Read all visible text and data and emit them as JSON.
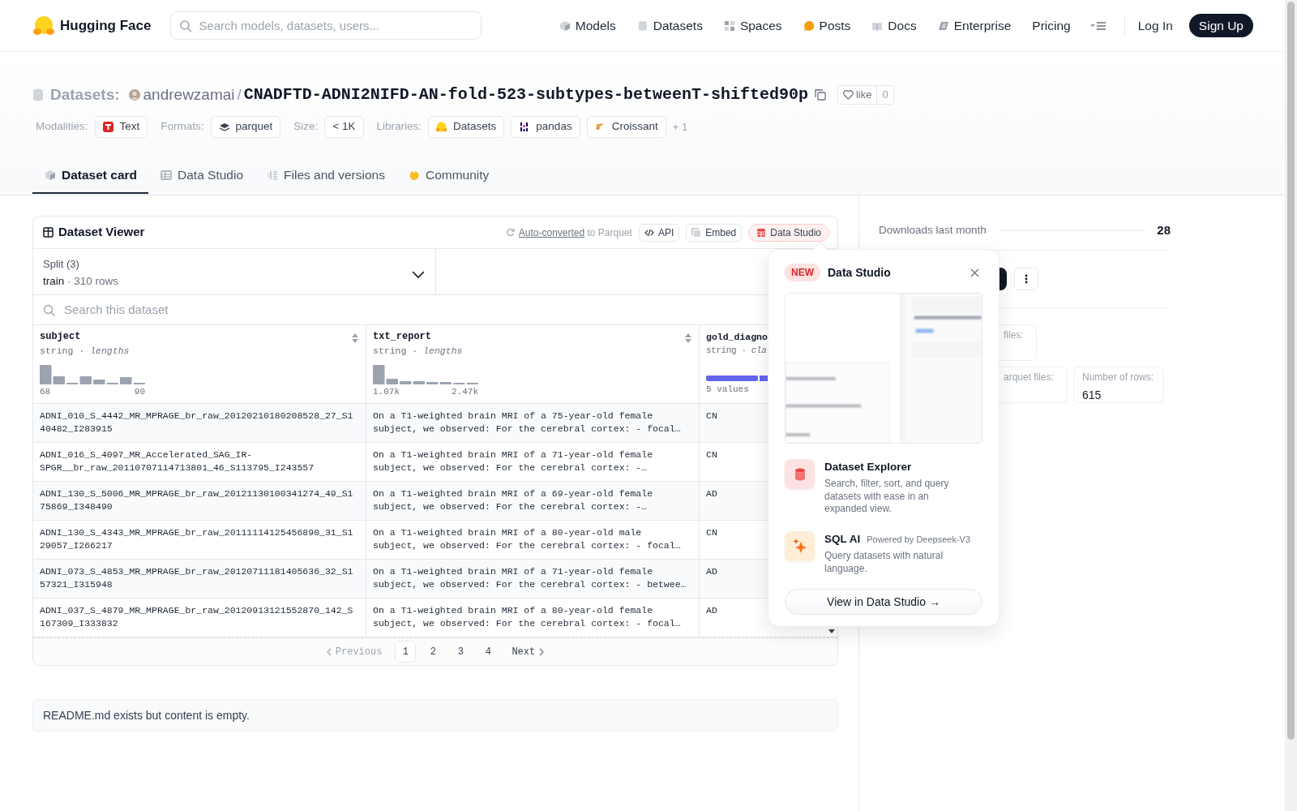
{
  "header": {
    "brand": "Hugging Face",
    "search": {
      "placeholder": "Search models, datasets, users..."
    },
    "nav": [
      {
        "label": "Models"
      },
      {
        "label": "Datasets"
      },
      {
        "label": "Spaces"
      },
      {
        "label": "Posts"
      },
      {
        "label": "Docs"
      },
      {
        "label": "Enterprise"
      },
      {
        "label": "Pricing"
      }
    ],
    "login": "Log In",
    "signup": "Sign Up"
  },
  "dataset": {
    "section": "Datasets:",
    "owner": "andrewzamai",
    "separator": "/",
    "name": "CNADFTD-ADNI2NIFD-AN-fold-523-subtypes-betweenT-shifted90p",
    "like": "like",
    "likes": "0"
  },
  "tags": [
    {
      "label": "Modalities:",
      "chips": [
        "Text"
      ]
    },
    {
      "label": "Formats:",
      "chips": [
        "parquet"
      ]
    },
    {
      "label": "Size:",
      "chips": [
        "< 1K"
      ]
    },
    {
      "label": "Libraries:",
      "chips": [
        "Datasets",
        "pandas",
        "Croissant"
      ]
    }
  ],
  "more_tags": "+ 1",
  "tabs": [
    {
      "label": "Dataset card",
      "selected": true
    },
    {
      "label": "Data Studio",
      "selected": false
    },
    {
      "label": "Files and versions",
      "selected": false
    },
    {
      "label": "Community",
      "selected": false
    }
  ],
  "viewer": {
    "title": "Dataset Viewer",
    "converted_link": "Auto-converted",
    "converted_text": "to Parquet",
    "buttons": [
      {
        "label": "API",
        "active": false
      },
      {
        "label": "Embed",
        "active": false
      },
      {
        "label": "Data Studio",
        "active": true
      }
    ],
    "split": {
      "label": "Split (3)",
      "value": "train",
      "dot": "·",
      "rows": "310 rows"
    },
    "search": {
      "placeholder": "Search this dataset"
    },
    "columns": [
      {
        "kind": "histogram",
        "name": "subject",
        "type": "string",
        "dot": "·",
        "stat": "lengths",
        "min": "68",
        "max": "90"
      },
      {
        "kind": "histogram",
        "name": "txt_report",
        "type": "string",
        "dot": "·",
        "stat": "lengths",
        "min": "1.07k",
        "max": "2.47k"
      },
      {
        "kind": "classes",
        "name": "gold_diagno",
        "type": "string",
        "dot": "·",
        "stat": "cla",
        "summary": "5 values"
      }
    ],
    "rows": [
      [
        "ADNI_010_S_4442_MR_MPRAGE_br_raw_20120210180208528_27_S140482_I283915",
        "On a T1-weighted brain MRI of a 75-year-old female subject, we observed: For the cerebral cortex: - focal…",
        "CN"
      ],
      [
        "ADNI_016_S_4097_MR_Accelerated_SAG_IR-SPGR__br_raw_20110707114713801_46_S113795_I243557",
        "On a T1-weighted brain MRI of a 71-year-old female subject, we observed: For the cerebral cortex: -…",
        "CN"
      ],
      [
        "ADNI_130_S_5006_MR_MPRAGE_br_raw_20121130100341274_49_S175869_I348490",
        "On a T1-weighted brain MRI of a 69-year-old female subject, we observed: For the cerebral cortex: -…",
        "AD"
      ],
      [
        "ADNI_130_S_4343_MR_MPRAGE_br_raw_20111114125456890_31_S129057_I266217",
        "On a T1-weighted brain MRI of a 80-year-old male subject, we observed: For the cerebral cortex: - focal…",
        "CN"
      ],
      [
        "ADNI_073_S_4853_MR_MPRAGE_br_raw_20120711181405636_32_S157321_I315948",
        "On a T1-weighted brain MRI of a 71-year-old female subject, we observed: For the cerebral cortex: - betwee…",
        "AD"
      ],
      [
        "ADNI_037_S_4879_MR_MPRAGE_br_raw_20120913121552870_142_S167309_I333832",
        "On a T1-weighted brain MRI of a 80-year-old female subject, we observed: For the cerebral cortex: - focal…",
        "AD"
      ]
    ],
    "pagination": {
      "previous": {
        "label": "Previous",
        "disabled": true
      },
      "next": {
        "label": "Next",
        "disabled": false
      },
      "pages": [
        {
          "label": "1",
          "selected": true
        },
        {
          "label": "2",
          "selected": false
        },
        {
          "label": "3",
          "selected": false
        },
        {
          "label": "4",
          "selected": false
        }
      ]
    }
  },
  "readme": "README.md exists but content is empty.",
  "sidebar": {
    "downloads_label": "Downloads last month",
    "downloads": "28",
    "stats": [
      {
        "label": "files:"
      },
      {
        "label": "arquet files:"
      },
      {
        "label": "Number of rows:",
        "value": "615"
      }
    ]
  },
  "popup": {
    "badge": "NEW",
    "title": "Data Studio",
    "features": [
      {
        "title": "Dataset Explorer",
        "description": "Search, filter, sort, and query datasets with ease in an expanded view."
      },
      {
        "title": "SQL AI",
        "note": "Powered by Deepseek-V3",
        "description": "Query datasets with natural language."
      }
    ],
    "button": "View in Data Studio →"
  }
}
